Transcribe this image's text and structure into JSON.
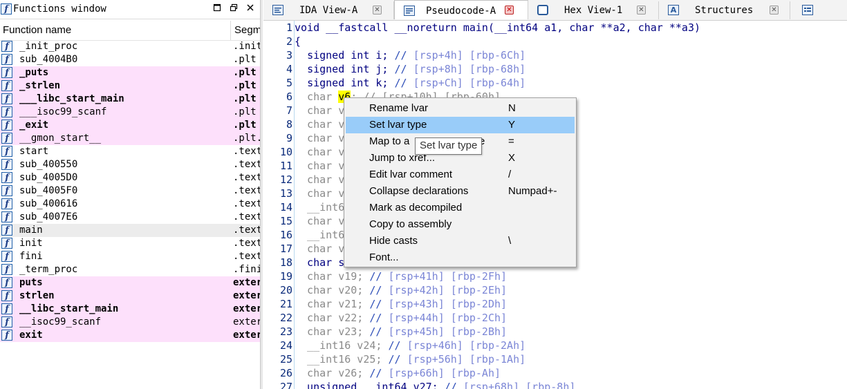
{
  "functions_window": {
    "title": "Functions window",
    "col_name": "Function name",
    "col_segment": "Segm",
    "rows": [
      {
        "name": "_init_proc",
        "segment": ".init",
        "style": "normal"
      },
      {
        "name": "sub_4004B0",
        "segment": ".plt",
        "style": "normal"
      },
      {
        "name": "_puts",
        "segment": ".plt",
        "style": "lib"
      },
      {
        "name": "_strlen",
        "segment": ".plt",
        "style": "lib"
      },
      {
        "name": "___libc_start_main",
        "segment": ".plt",
        "style": "lib"
      },
      {
        "name": "___isoc99_scanf",
        "segment": ".plt",
        "style": "libnb"
      },
      {
        "name": "_exit",
        "segment": ".plt",
        "style": "lib"
      },
      {
        "name": "__gmon_start__",
        "segment": ".plt.",
        "style": "libnb"
      },
      {
        "name": "start",
        "segment": ".text",
        "style": "normal"
      },
      {
        "name": "sub_400550",
        "segment": ".text",
        "style": "normal"
      },
      {
        "name": "sub_4005D0",
        "segment": ".text",
        "style": "normal"
      },
      {
        "name": "sub_4005F0",
        "segment": ".text",
        "style": "normal"
      },
      {
        "name": "sub_400616",
        "segment": ".text",
        "style": "normal"
      },
      {
        "name": "sub_4007E6",
        "segment": ".text",
        "style": "normal"
      },
      {
        "name": "main",
        "segment": ".text",
        "style": "sel"
      },
      {
        "name": "init",
        "segment": ".text",
        "style": "normal"
      },
      {
        "name": "fini",
        "segment": ".text",
        "style": "normal"
      },
      {
        "name": "_term_proc",
        "segment": ".fini",
        "style": "normal"
      },
      {
        "name": "puts",
        "segment": "exter",
        "style": "lib"
      },
      {
        "name": "strlen",
        "segment": "exter",
        "style": "lib"
      },
      {
        "name": "__libc_start_main",
        "segment": "exter",
        "style": "lib"
      },
      {
        "name": "__isoc99_scanf",
        "segment": "exter",
        "style": "libnb"
      },
      {
        "name": "exit",
        "segment": "exter",
        "style": "lib"
      }
    ]
  },
  "tabs": [
    {
      "label": "IDA View-A",
      "icon": "ida-view-icon",
      "active": false
    },
    {
      "label": "Pseudocode-A",
      "icon": "pseudocode-icon",
      "active": true
    },
    {
      "label": "Hex View-1",
      "icon": "hex-view-icon",
      "active": false
    },
    {
      "label": "Structures",
      "icon": "structures-icon",
      "active": false
    },
    {
      "label": "",
      "icon": "enums-icon",
      "active": false
    }
  ],
  "code_lines": [
    {
      "n": "1",
      "parts": [
        [
          "pl",
          "void __fastcall __noreturn main(__int64 a1, char **a2, char **a3)"
        ]
      ]
    },
    {
      "n": "2",
      "parts": [
        [
          "pl",
          "{"
        ]
      ]
    },
    {
      "n": "3",
      "parts": [
        [
          "pl",
          "  "
        ],
        [
          "kw",
          "signed int i; "
        ],
        [
          "cm",
          "// "
        ],
        [
          "off",
          "[rsp+4h] [rbp-6Ch]"
        ]
      ]
    },
    {
      "n": "4",
      "parts": [
        [
          "pl",
          "  "
        ],
        [
          "kw",
          "signed int j; "
        ],
        [
          "cm",
          "// "
        ],
        [
          "off",
          "[rsp+8h] [rbp-68h]"
        ]
      ]
    },
    {
      "n": "5",
      "parts": [
        [
          "pl",
          "  "
        ],
        [
          "kw",
          "signed int k; "
        ],
        [
          "cm",
          "// "
        ],
        [
          "off",
          "[rsp+Ch] [rbp-64h]"
        ]
      ]
    },
    {
      "n": "6",
      "parts": [
        [
          "dim",
          "  char "
        ],
        [
          "hl",
          "v6"
        ],
        [
          "dim",
          "; // [rsp+10h] [rbp-60h]"
        ]
      ]
    },
    {
      "n": "7",
      "parts": [
        [
          "dim",
          "  char v"
        ]
      ]
    },
    {
      "n": "8",
      "parts": [
        [
          "dim",
          "  char v"
        ]
      ]
    },
    {
      "n": "9",
      "parts": [
        [
          "dim",
          "  char v"
        ]
      ]
    },
    {
      "n": "10",
      "parts": [
        [
          "dim",
          "  char v"
        ]
      ]
    },
    {
      "n": "11",
      "parts": [
        [
          "dim",
          "  char v"
        ]
      ]
    },
    {
      "n": "12",
      "parts": [
        [
          "dim",
          "  char v"
        ]
      ]
    },
    {
      "n": "13",
      "parts": [
        [
          "dim",
          "  char v"
        ]
      ]
    },
    {
      "n": "14",
      "parts": [
        [
          "dim",
          "  __int6"
        ]
      ]
    },
    {
      "n": "15",
      "parts": [
        [
          "dim",
          "  char v"
        ]
      ]
    },
    {
      "n": "16",
      "parts": [
        [
          "dim",
          "  __int6"
        ]
      ]
    },
    {
      "n": "17",
      "parts": [
        [
          "dim",
          "  char v"
        ]
      ]
    },
    {
      "n": "18",
      "parts": [
        [
          "kw",
          "  char s"
        ]
      ]
    },
    {
      "n": "19",
      "parts": [
        [
          "dim",
          "  char v19; "
        ],
        [
          "cm",
          "// "
        ],
        [
          "off",
          "[rsp+41h] [rbp-2Fh]"
        ]
      ]
    },
    {
      "n": "20",
      "parts": [
        [
          "dim",
          "  char v20; "
        ],
        [
          "cm",
          "// "
        ],
        [
          "off",
          "[rsp+42h] [rbp-2Eh]"
        ]
      ]
    },
    {
      "n": "21",
      "parts": [
        [
          "dim",
          "  char v21; "
        ],
        [
          "cm",
          "// "
        ],
        [
          "off",
          "[rsp+43h] [rbp-2Dh]"
        ]
      ]
    },
    {
      "n": "22",
      "parts": [
        [
          "dim",
          "  char v22; "
        ],
        [
          "cm",
          "// "
        ],
        [
          "off",
          "[rsp+44h] [rbp-2Ch]"
        ]
      ]
    },
    {
      "n": "23",
      "parts": [
        [
          "dim",
          "  char v23; "
        ],
        [
          "cm",
          "// "
        ],
        [
          "off",
          "[rsp+45h] [rbp-2Bh]"
        ]
      ]
    },
    {
      "n": "24",
      "parts": [
        [
          "dim",
          "  __int16 v24; "
        ],
        [
          "cm",
          "// "
        ],
        [
          "off",
          "[rsp+46h] [rbp-2Ah]"
        ]
      ]
    },
    {
      "n": "25",
      "parts": [
        [
          "dim",
          "  __int16 v25; "
        ],
        [
          "cm",
          "// "
        ],
        [
          "off",
          "[rsp+56h] [rbp-1Ah]"
        ]
      ]
    },
    {
      "n": "26",
      "parts": [
        [
          "dim",
          "  char v26; "
        ],
        [
          "cm",
          "// "
        ],
        [
          "off",
          "[rsp+66h] [rbp-Ah]"
        ]
      ]
    },
    {
      "n": "27",
      "parts": [
        [
          "kw",
          "  unsigned __int64 v27; "
        ],
        [
          "cm",
          "// "
        ],
        [
          "off",
          "[rsp+68h] [rbp-8h]"
        ]
      ]
    }
  ],
  "context_menu": {
    "items": [
      {
        "label": "Rename lvar",
        "shortcut": "N",
        "hover": false
      },
      {
        "label": "Set lvar type",
        "shortcut": "Y",
        "hover": true
      },
      {
        "label": "Map to a",
        "shortcut": "=",
        "hover": false
      },
      {
        "label": "Jump to xref...",
        "shortcut": "X",
        "hover": false
      },
      {
        "label": "Edit lvar comment",
        "shortcut": "/",
        "hover": false
      },
      {
        "label": "Collapse declarations",
        "shortcut": "Numpad+-",
        "hover": false
      },
      {
        "label": "Mark as decompiled",
        "shortcut": "",
        "hover": false
      },
      {
        "label": "Copy to assembly",
        "shortcut": "",
        "hover": false
      },
      {
        "label": "Hide casts",
        "shortcut": "\\",
        "hover": false
      },
      {
        "label": "Font...",
        "shortcut": "",
        "hover": false
      }
    ],
    "map_to_suffix": "e"
  },
  "tooltip": "Set lvar type",
  "titlebar_buttons": {
    "restore": "🗗",
    "maximize": "⧉",
    "close": "✕"
  }
}
